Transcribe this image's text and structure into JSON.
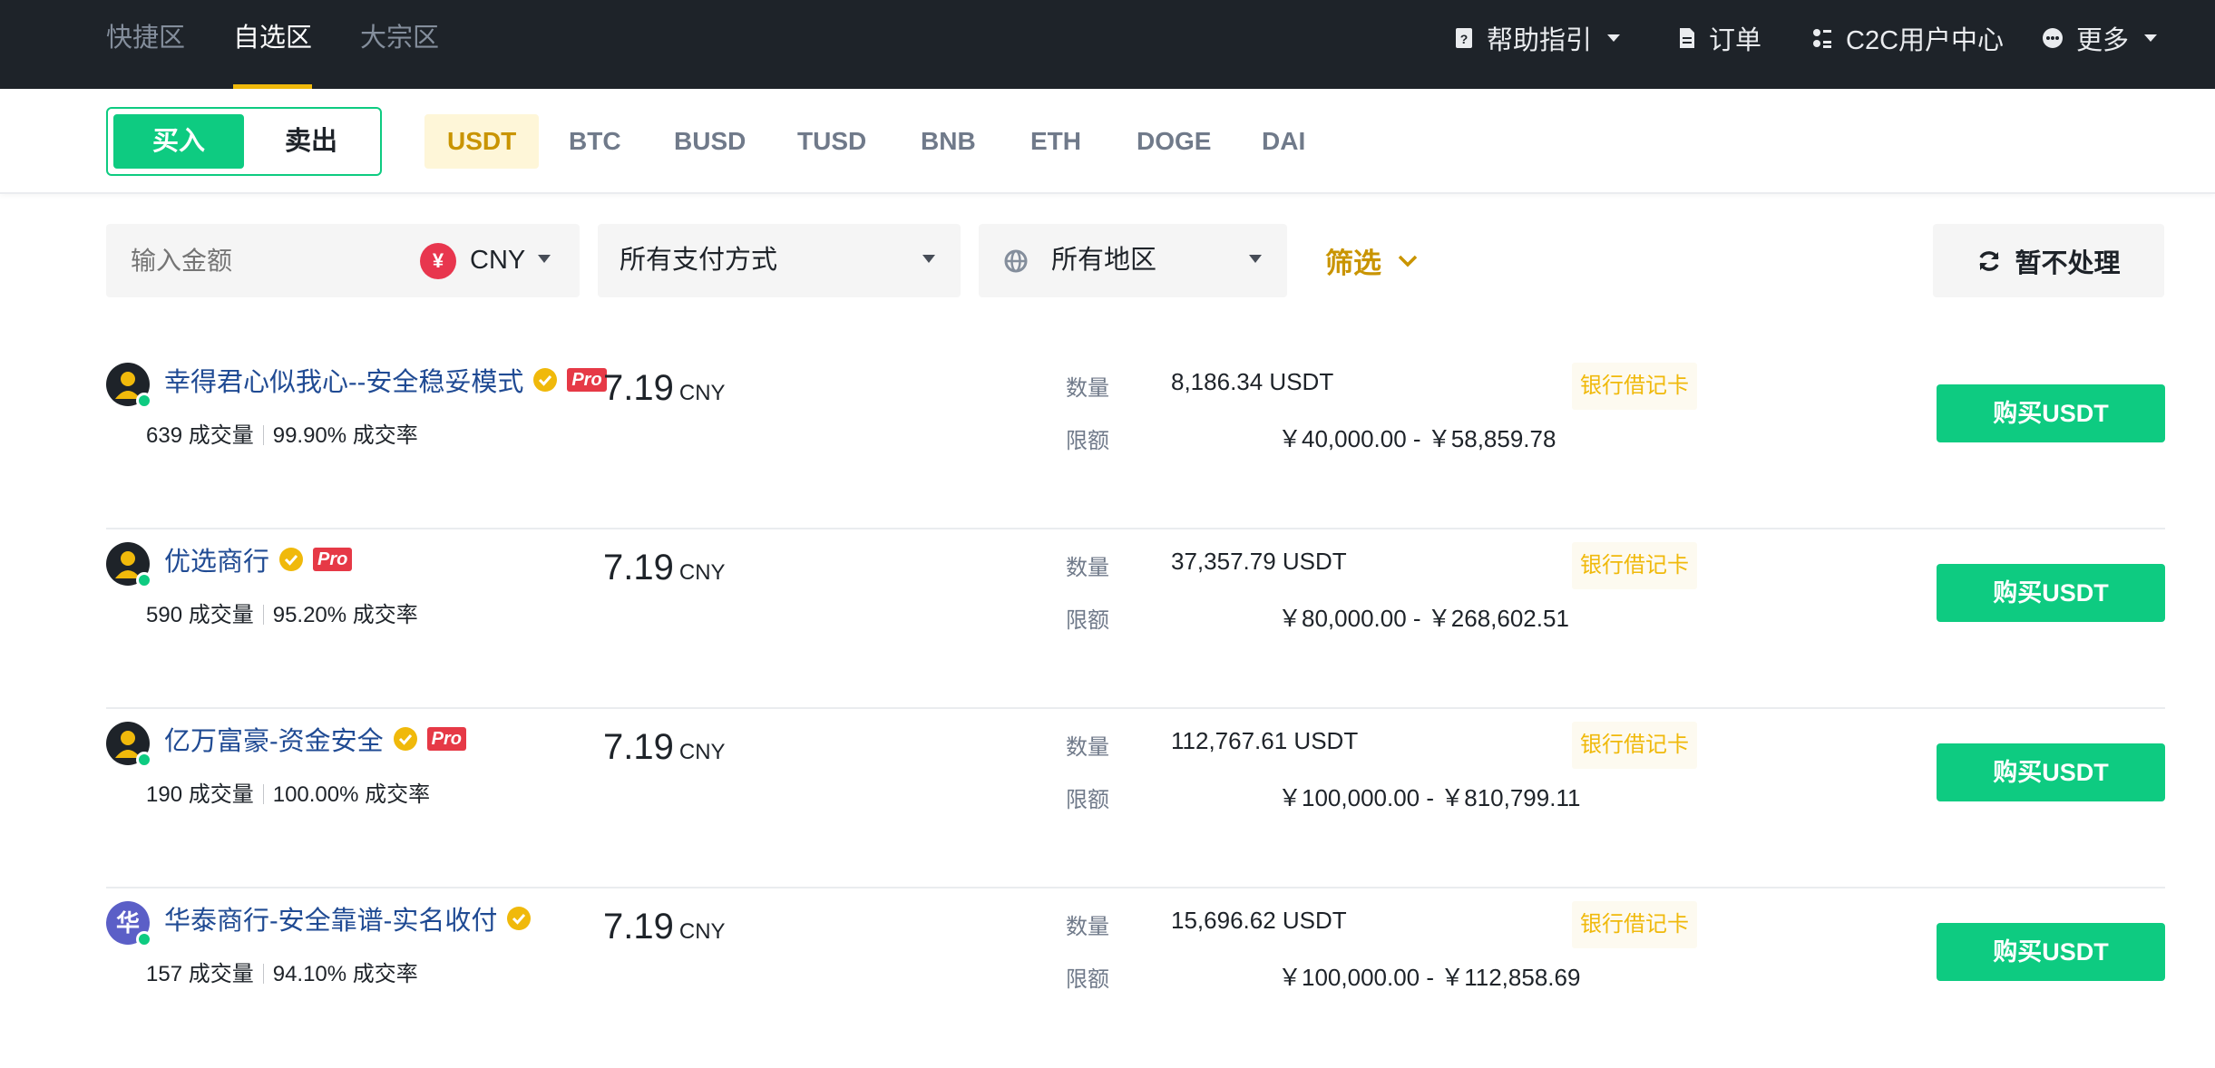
{
  "nav": {
    "tabs": [
      {
        "label": "快捷区"
      },
      {
        "label": "自选区",
        "active": true
      },
      {
        "label": "大宗区"
      }
    ],
    "help": "帮助指引",
    "orders": "订单",
    "c2c": "C2C用户中心",
    "more": "更多"
  },
  "trade": {
    "buy": "买入",
    "sell": "卖出",
    "coins": [
      "USDT",
      "BTC",
      "BUSD",
      "TUSD",
      "BNB",
      "ETH",
      "DOGE",
      "DAI"
    ],
    "active_coin": "USDT"
  },
  "filters": {
    "amount_placeholder": "输入金额",
    "currency": "CNY",
    "currency_symbol": "¥",
    "payment": "所有支付方式",
    "region": "所有地区",
    "filter": "筛选",
    "refresh": "暂不处理"
  },
  "labels": {
    "quantity": "数量",
    "limit": "限额",
    "trades": "成交量",
    "completion": "成交率",
    "price_currency": "CNY"
  },
  "ads": [
    {
      "merchant": "幸得君心似我心--安全稳妥模式",
      "avatar": "",
      "pro": "Pro",
      "trades": "639",
      "completion": "99.90%",
      "price": "7.19",
      "quantity": "8,186.34 USDT",
      "limit": "￥40,000.00 - ￥58,859.78",
      "payment": "银行借记卡",
      "button": "购买USDT"
    },
    {
      "merchant": "优选商行",
      "avatar": "",
      "pro": "Pro",
      "trades": "590",
      "completion": "95.20%",
      "price": "7.19",
      "quantity": "37,357.79 USDT",
      "limit": "￥80,000.00 - ￥268,602.51",
      "payment": "银行借记卡",
      "button": "购买USDT"
    },
    {
      "merchant": "亿万富豪-资金安全",
      "avatar": "",
      "pro": "Pro",
      "trades": "190",
      "completion": "100.00%",
      "price": "7.19",
      "quantity": "112,767.61 USDT",
      "limit": "￥100,000.00 - ￥810,799.11",
      "payment": "银行借记卡",
      "button": "购买USDT"
    },
    {
      "merchant": "华泰商行-安全靠谱-实名收付",
      "avatar": "华",
      "pro": "",
      "trades": "157",
      "completion": "94.10%",
      "price": "7.19",
      "quantity": "15,696.62 USDT",
      "limit": "￥100,000.00 - ￥112,858.69",
      "payment": "银行借记卡",
      "button": "购买USDT"
    }
  ],
  "colors": {
    "nav_bg": "#1e2329",
    "brand_yellow": "#f0b90b",
    "buy_green": "#0ecb81",
    "merchant_link": "#1f4a93"
  }
}
